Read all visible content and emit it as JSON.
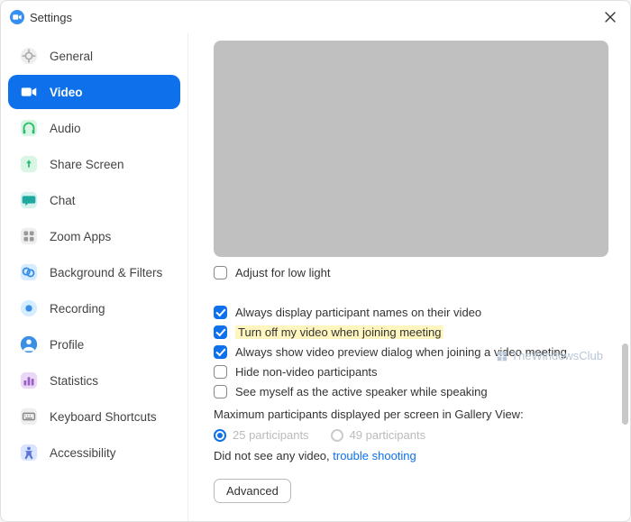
{
  "window": {
    "title": "Settings"
  },
  "sidebar": {
    "items": [
      {
        "label": "General"
      },
      {
        "label": "Video"
      },
      {
        "label": "Audio"
      },
      {
        "label": "Share Screen"
      },
      {
        "label": "Chat"
      },
      {
        "label": "Zoom Apps"
      },
      {
        "label": "Background & Filters"
      },
      {
        "label": "Recording"
      },
      {
        "label": "Profile"
      },
      {
        "label": "Statistics"
      },
      {
        "label": "Keyboard Shortcuts"
      },
      {
        "label": "Accessibility"
      }
    ]
  },
  "video": {
    "adjust_low_light": "Adjust for low light",
    "opt1": "Always display participant names on their video",
    "opt2": "Turn off my video when joining meeting",
    "opt3": "Always show video preview dialog when joining a video meeting",
    "opt4": "Hide non-video participants",
    "opt5": "See myself as the active speaker while speaking",
    "max_label": "Maximum participants displayed per screen in Gallery View:",
    "radio1": "25 participants",
    "radio2": "49 participants",
    "novideo_pre": "Did not see any video, ",
    "novideo_link": "trouble shooting",
    "advanced": "Advanced"
  },
  "watermark": "TheWindowsClub"
}
